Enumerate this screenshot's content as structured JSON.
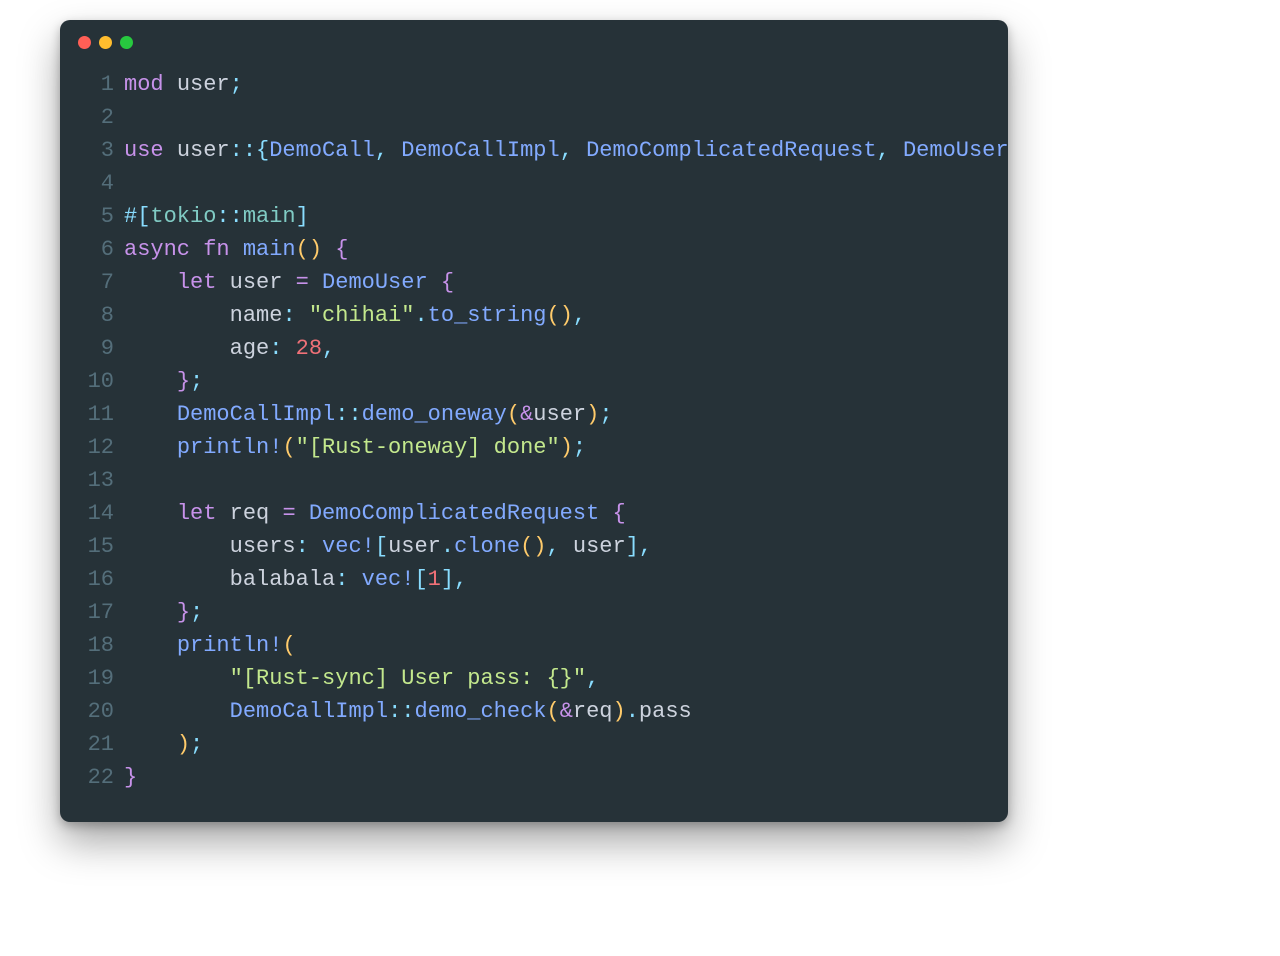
{
  "window": {
    "dots": {
      "red": "#ff5f56",
      "yellow": "#ffbd2e",
      "green": "#27c93f"
    }
  },
  "code": {
    "lines": [
      {
        "n": 1,
        "t": [
          {
            "c": "kw",
            "v": "mod"
          },
          {
            "c": "punct",
            "v": " "
          },
          {
            "c": "ident",
            "v": "user"
          },
          {
            "c": "punct",
            "v": ";"
          }
        ]
      },
      {
        "n": 2,
        "t": []
      },
      {
        "n": 3,
        "t": [
          {
            "c": "kw",
            "v": "use"
          },
          {
            "c": "punct",
            "v": " "
          },
          {
            "c": "ident",
            "v": "user"
          },
          {
            "c": "punct",
            "v": "::"
          },
          {
            "c": "punct",
            "v": "{"
          },
          {
            "c": "ty",
            "v": "DemoCall"
          },
          {
            "c": "punct",
            "v": ", "
          },
          {
            "c": "ty",
            "v": "DemoCallImpl"
          },
          {
            "c": "punct",
            "v": ", "
          },
          {
            "c": "ty",
            "v": "DemoComplicatedRequest"
          },
          {
            "c": "punct",
            "v": ", "
          },
          {
            "c": "ty",
            "v": "DemoUser"
          },
          {
            "c": "punct",
            "v": "};"
          }
        ]
      },
      {
        "n": 4,
        "t": []
      },
      {
        "n": 5,
        "t": [
          {
            "c": "punct",
            "v": "#["
          },
          {
            "c": "attrty",
            "v": "tokio"
          },
          {
            "c": "punct",
            "v": "::"
          },
          {
            "c": "attrty",
            "v": "main"
          },
          {
            "c": "punct",
            "v": "]"
          }
        ]
      },
      {
        "n": 6,
        "t": [
          {
            "c": "kw",
            "v": "async"
          },
          {
            "c": "punct",
            "v": " "
          },
          {
            "c": "kw",
            "v": "fn"
          },
          {
            "c": "punct",
            "v": " "
          },
          {
            "c": "fnname",
            "v": "main"
          },
          {
            "c": "paren",
            "v": "()"
          },
          {
            "c": "punct",
            "v": " "
          },
          {
            "c": "brace",
            "v": "{"
          }
        ]
      },
      {
        "n": 7,
        "t": [
          {
            "c": "punct",
            "v": "    "
          },
          {
            "c": "kw",
            "v": "let"
          },
          {
            "c": "punct",
            "v": " "
          },
          {
            "c": "ident",
            "v": "user"
          },
          {
            "c": "punct",
            "v": " "
          },
          {
            "c": "op",
            "v": "="
          },
          {
            "c": "punct",
            "v": " "
          },
          {
            "c": "ty",
            "v": "DemoUser"
          },
          {
            "c": "punct",
            "v": " "
          },
          {
            "c": "brace",
            "v": "{"
          }
        ]
      },
      {
        "n": 8,
        "t": [
          {
            "c": "punct",
            "v": "        "
          },
          {
            "c": "field",
            "v": "name"
          },
          {
            "c": "punct",
            "v": ": "
          },
          {
            "c": "str",
            "v": "\"chihai\""
          },
          {
            "c": "punct",
            "v": "."
          },
          {
            "c": "call",
            "v": "to_string"
          },
          {
            "c": "paren",
            "v": "()"
          },
          {
            "c": "punct",
            "v": ","
          }
        ]
      },
      {
        "n": 9,
        "t": [
          {
            "c": "punct",
            "v": "        "
          },
          {
            "c": "field",
            "v": "age"
          },
          {
            "c": "punct",
            "v": ": "
          },
          {
            "c": "num",
            "v": "28"
          },
          {
            "c": "punct",
            "v": ","
          }
        ]
      },
      {
        "n": 10,
        "t": [
          {
            "c": "punct",
            "v": "    "
          },
          {
            "c": "brace",
            "v": "}"
          },
          {
            "c": "punct",
            "v": ";"
          }
        ]
      },
      {
        "n": 11,
        "t": [
          {
            "c": "punct",
            "v": "    "
          },
          {
            "c": "ty",
            "v": "DemoCallImpl"
          },
          {
            "c": "punct",
            "v": "::"
          },
          {
            "c": "call",
            "v": "demo_oneway"
          },
          {
            "c": "paren",
            "v": "("
          },
          {
            "c": "op",
            "v": "&"
          },
          {
            "c": "ident",
            "v": "user"
          },
          {
            "c": "paren",
            "v": ")"
          },
          {
            "c": "punct",
            "v": ";"
          }
        ]
      },
      {
        "n": 12,
        "t": [
          {
            "c": "punct",
            "v": "    "
          },
          {
            "c": "macro",
            "v": "println!"
          },
          {
            "c": "paren",
            "v": "("
          },
          {
            "c": "str",
            "v": "\"[Rust-oneway] done\""
          },
          {
            "c": "paren",
            "v": ")"
          },
          {
            "c": "punct",
            "v": ";"
          }
        ]
      },
      {
        "n": 13,
        "t": []
      },
      {
        "n": 14,
        "t": [
          {
            "c": "punct",
            "v": "    "
          },
          {
            "c": "kw",
            "v": "let"
          },
          {
            "c": "punct",
            "v": " "
          },
          {
            "c": "ident",
            "v": "req"
          },
          {
            "c": "punct",
            "v": " "
          },
          {
            "c": "op",
            "v": "="
          },
          {
            "c": "punct",
            "v": " "
          },
          {
            "c": "ty",
            "v": "DemoComplicatedRequest"
          },
          {
            "c": "punct",
            "v": " "
          },
          {
            "c": "brace",
            "v": "{"
          }
        ]
      },
      {
        "n": 15,
        "t": [
          {
            "c": "punct",
            "v": "        "
          },
          {
            "c": "field",
            "v": "users"
          },
          {
            "c": "punct",
            "v": ": "
          },
          {
            "c": "macro",
            "v": "vec!"
          },
          {
            "c": "punct",
            "v": "["
          },
          {
            "c": "ident",
            "v": "user"
          },
          {
            "c": "punct",
            "v": "."
          },
          {
            "c": "call",
            "v": "clone"
          },
          {
            "c": "paren",
            "v": "()"
          },
          {
            "c": "punct",
            "v": ", "
          },
          {
            "c": "ident",
            "v": "user"
          },
          {
            "c": "punct",
            "v": "],"
          }
        ]
      },
      {
        "n": 16,
        "t": [
          {
            "c": "punct",
            "v": "        "
          },
          {
            "c": "field",
            "v": "balabala"
          },
          {
            "c": "punct",
            "v": ": "
          },
          {
            "c": "macro",
            "v": "vec!"
          },
          {
            "c": "punct",
            "v": "["
          },
          {
            "c": "num",
            "v": "1"
          },
          {
            "c": "punct",
            "v": "],"
          }
        ]
      },
      {
        "n": 17,
        "t": [
          {
            "c": "punct",
            "v": "    "
          },
          {
            "c": "brace",
            "v": "}"
          },
          {
            "c": "punct",
            "v": ";"
          }
        ]
      },
      {
        "n": 18,
        "t": [
          {
            "c": "punct",
            "v": "    "
          },
          {
            "c": "macro",
            "v": "println!"
          },
          {
            "c": "paren",
            "v": "("
          }
        ]
      },
      {
        "n": 19,
        "t": [
          {
            "c": "punct",
            "v": "        "
          },
          {
            "c": "str",
            "v": "\"[Rust-sync] User pass: {}\""
          },
          {
            "c": "punct",
            "v": ","
          }
        ]
      },
      {
        "n": 20,
        "t": [
          {
            "c": "punct",
            "v": "        "
          },
          {
            "c": "ty",
            "v": "DemoCallImpl"
          },
          {
            "c": "punct",
            "v": "::"
          },
          {
            "c": "call",
            "v": "demo_check"
          },
          {
            "c": "paren",
            "v": "("
          },
          {
            "c": "op",
            "v": "&"
          },
          {
            "c": "ident",
            "v": "req"
          },
          {
            "c": "paren",
            "v": ")"
          },
          {
            "c": "punct",
            "v": "."
          },
          {
            "c": "field",
            "v": "pass"
          }
        ]
      },
      {
        "n": 21,
        "t": [
          {
            "c": "punct",
            "v": "    "
          },
          {
            "c": "paren",
            "v": ")"
          },
          {
            "c": "punct",
            "v": ";"
          }
        ]
      },
      {
        "n": 22,
        "t": [
          {
            "c": "brace",
            "v": "}"
          }
        ]
      }
    ]
  }
}
